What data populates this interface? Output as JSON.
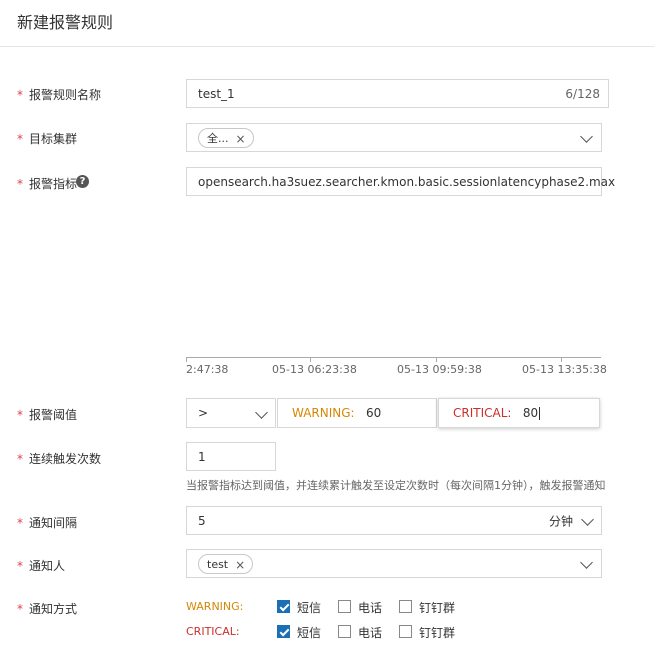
{
  "header": {
    "title": "新建报警规则"
  },
  "rule_name": {
    "label": "报警规则名称",
    "value": "test_1",
    "counter": "6/128"
  },
  "target_cluster": {
    "label": "目标集群",
    "tag": "全..."
  },
  "metric": {
    "label": "报警指标",
    "value": "opensearch.ha3suez.searcher.kmon.basic.sessionlatencyphase2.max"
  },
  "timeline": {
    "ticks": [
      "2:47:38",
      "05-13 06:23:38",
      "05-13 09:59:38",
      "05-13 13:35:38"
    ]
  },
  "threshold": {
    "label": "报警阈值",
    "operator": ">",
    "warning_label": "WARNING:",
    "warning_value": "60",
    "critical_label": "CRITICAL:",
    "critical_value": "80"
  },
  "consecutive": {
    "label": "连续触发次数",
    "value": "1",
    "hint": "当报警指标达到阈值，并连续累计触发至设定次数时（每次间隔1分钟），触发报警通知"
  },
  "interval": {
    "label": "通知间隔",
    "value": "5",
    "unit": "分钟"
  },
  "notify_people": {
    "label": "通知人",
    "tag": "test"
  },
  "notify_method": {
    "label": "通知方式",
    "rows": [
      {
        "level": "WARNING:",
        "options": [
          {
            "label": "短信",
            "checked": true
          },
          {
            "label": "电话",
            "checked": false
          },
          {
            "label": "钉钉群",
            "checked": false
          }
        ]
      },
      {
        "level": "CRITICAL:",
        "options": [
          {
            "label": "短信",
            "checked": true
          },
          {
            "label": "电话",
            "checked": false
          },
          {
            "label": "钉钉群",
            "checked": false
          }
        ]
      }
    ]
  },
  "colors": {
    "required": "#e1404b",
    "warning": "#d48806",
    "critical": "#c9302c",
    "checkbox": "#1a6fb5"
  }
}
